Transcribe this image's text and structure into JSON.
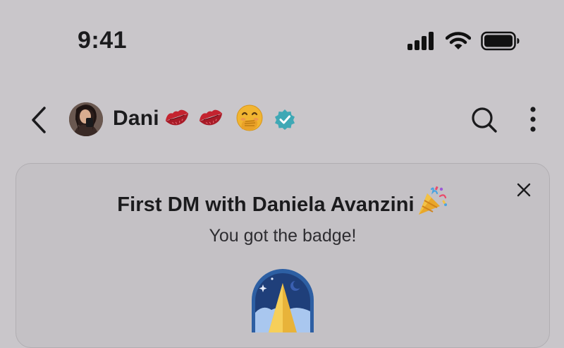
{
  "status_bar": {
    "time": "9:41",
    "signal_icon": "cellular-signal-icon",
    "wifi_icon": "wifi-icon",
    "battery_icon": "battery-icon"
  },
  "header": {
    "back_icon": "chevron-left-icon",
    "contact_name": "Dani",
    "name_emojis": [
      "kiss-mark-icon",
      "kiss-mark-icon",
      "face-hand-over-mouth-icon"
    ],
    "verified_icon": "verified-badge-icon",
    "search_icon": "search-icon",
    "more_icon": "more-vertical-icon"
  },
  "badge_card": {
    "title": "First DM with Daniela Avanzini",
    "title_icon": "party-popper-icon",
    "subtitle": "You got the badge!",
    "close_icon": "close-icon",
    "badge_icon": "badge-icon"
  },
  "colors": {
    "background": "#c9c6ca",
    "card_background": "#c4c1c5",
    "text": "#1b1b1d",
    "verified": "#3fa8b5"
  }
}
